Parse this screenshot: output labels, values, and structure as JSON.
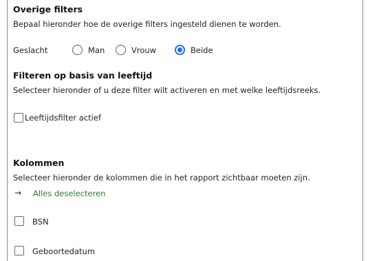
{
  "overige": {
    "title": "Overige filters",
    "description": "Bepaal hieronder hoe de overige filters ingesteld dienen te worden.",
    "gender_label": "Geslacht",
    "options": [
      {
        "label": "Man",
        "checked": false
      },
      {
        "label": "Vrouw",
        "checked": false
      },
      {
        "label": "Beide",
        "checked": true
      }
    ]
  },
  "leeftijd": {
    "title": "Filteren op basis van leeftijd",
    "description": "Selecteer hieronder of u deze filter wilt activeren en met welke leeftijdsreeks.",
    "checkbox_label": "Leeftijdsfilter actief",
    "checked": false
  },
  "kolommen": {
    "title": "Kolommen",
    "description": "Selecteer hieronder de kolommen die in het rapport zichtbaar moeten zijn.",
    "deselect_arrow": "→",
    "deselect_label": "Alles deselecteren",
    "columns": [
      {
        "label": "BSN",
        "checked": false
      },
      {
        "label": "Geboortedatum",
        "checked": false
      }
    ]
  },
  "colors": {
    "accent": "#1a73e8",
    "link": "#2e7d32"
  }
}
